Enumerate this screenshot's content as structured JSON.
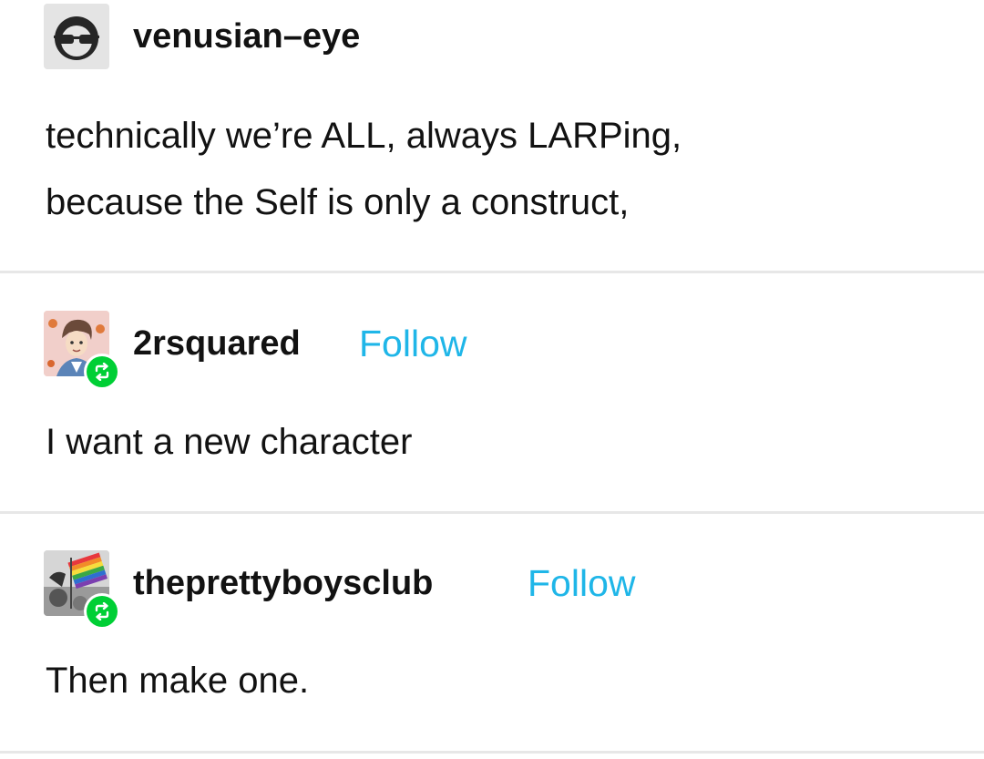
{
  "posts": [
    {
      "username": "venusian–eye",
      "lines": [
        "technically we’re ALL, always LARPing,",
        "because the Self is only a construct,"
      ]
    },
    {
      "username": "2rsquared",
      "follow_label": "Follow",
      "reblog_icon": "reblog-icon",
      "lines": [
        "I want a new character"
      ]
    },
    {
      "username": "theprettyboysclub",
      "follow_label": "Follow",
      "reblog_icon": "reblog-icon",
      "lines": [
        "Then make one."
      ]
    }
  ],
  "colors": {
    "follow": "#1fb6e8",
    "reblog_badge": "#00cf35",
    "separator": "#e7e7e7",
    "text": "#121212"
  }
}
